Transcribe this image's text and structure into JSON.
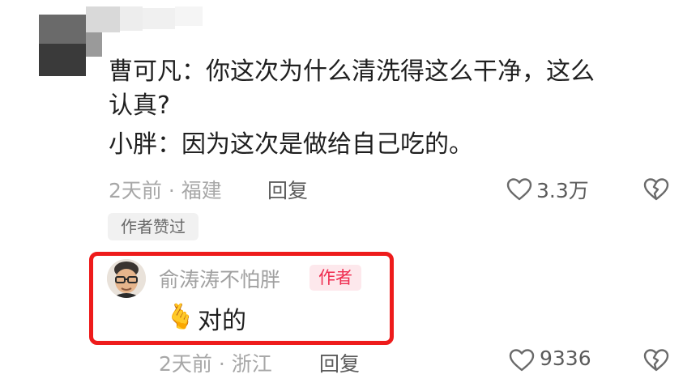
{
  "comment": {
    "lines": [
      "曹可凡：你这次为什么清洗得这么干净，这么",
      "认真?",
      "小胖：因为这次是做给自己吃的。"
    ],
    "time": "2天前",
    "location": "福建",
    "meta_separator": "·",
    "reply_label": "回复",
    "like_count": "3.3万",
    "liked_by_author": "作者赞过"
  },
  "reply": {
    "author_name": "俞涛涛不怕胖",
    "author_badge": "作者",
    "emoji": "🫰",
    "text": "对的",
    "time": "2天前",
    "location": "浙江",
    "meta_separator": "·",
    "reply_label": "回复",
    "like_count": "9336"
  },
  "colors": {
    "highlight_border": "#ee1b1b",
    "author_badge_text": "#ef2d50",
    "author_badge_bg": "#fde8ec"
  },
  "icons": [
    "heart-icon",
    "broken-heart-icon"
  ]
}
